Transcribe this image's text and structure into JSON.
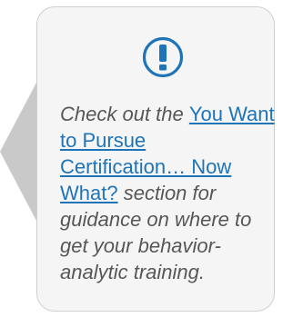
{
  "callout": {
    "icon": "exclamation-circle-icon",
    "text_before": "Check out the ",
    "link_text": "You Want to Pursue Certification… Now What?",
    "text_after": " section for guidance on where to get your behavior-analytic training.",
    "colors": {
      "icon": "#1f74b8",
      "link": "#1f74b8",
      "text": "#575757",
      "box_background": "#f5f5f5",
      "box_border": "#cfcfcf",
      "arrow": "#c9c9c9"
    }
  }
}
